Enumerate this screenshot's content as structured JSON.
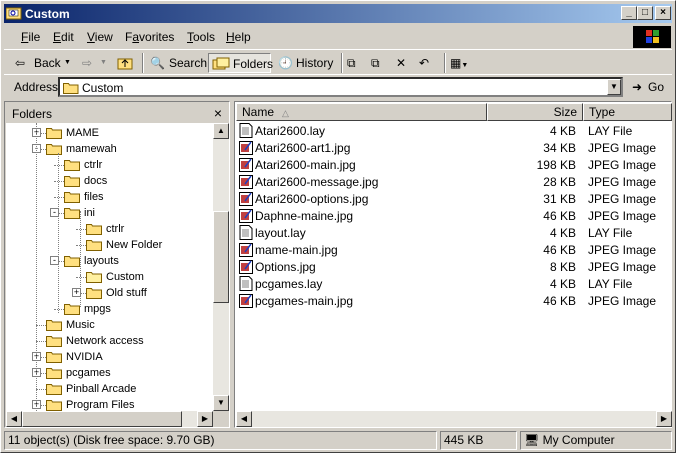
{
  "window": {
    "title": "Custom"
  },
  "menu": [
    "File",
    "Edit",
    "View",
    "Favorites",
    "Tools",
    "Help"
  ],
  "menu_underline": [
    "F",
    "E",
    "V",
    "a",
    "T",
    "H"
  ],
  "toolbar": {
    "back": "Back",
    "search": "Search",
    "folders": "Folders",
    "history": "History"
  },
  "address": {
    "label": "Address",
    "value": "Custom",
    "go": "Go"
  },
  "folders_pane": {
    "title": "Folders"
  },
  "tree": [
    {
      "label": "MAME",
      "indent": 0,
      "exp": "+"
    },
    {
      "label": "mamewah",
      "indent": 0,
      "exp": "-"
    },
    {
      "label": "ctrlr",
      "indent": 1,
      "exp": ""
    },
    {
      "label": "docs",
      "indent": 1,
      "exp": ""
    },
    {
      "label": "files",
      "indent": 1,
      "exp": ""
    },
    {
      "label": "ini",
      "indent": 1,
      "exp": "-"
    },
    {
      "label": "ctrlr",
      "indent": 2,
      "exp": ""
    },
    {
      "label": "New Folder",
      "indent": 2,
      "exp": ""
    },
    {
      "label": "layouts",
      "indent": 1,
      "exp": "-"
    },
    {
      "label": "Custom",
      "indent": 2,
      "exp": "",
      "open": true
    },
    {
      "label": "Old stuff",
      "indent": 2,
      "exp": "+"
    },
    {
      "label": "mpgs",
      "indent": 1,
      "exp": ""
    },
    {
      "label": "Music",
      "indent": 0,
      "exp": ""
    },
    {
      "label": "Network access",
      "indent": 0,
      "exp": ""
    },
    {
      "label": "NVIDIA",
      "indent": 0,
      "exp": "+"
    },
    {
      "label": "pcgames",
      "indent": 0,
      "exp": "+"
    },
    {
      "label": "Pinball Arcade",
      "indent": 0,
      "exp": ""
    },
    {
      "label": "Program Files",
      "indent": 0,
      "exp": "+"
    }
  ],
  "columns": {
    "name": "Name",
    "size": "Size",
    "type": "Type"
  },
  "files": [
    {
      "name": "Atari2600.lay",
      "size": "4 KB",
      "type": "LAY File",
      "kind": "lay"
    },
    {
      "name": "Atari2600-art1.jpg",
      "size": "34 KB",
      "type": "JPEG Image",
      "kind": "jpg"
    },
    {
      "name": "Atari2600-main.jpg",
      "size": "198 KB",
      "type": "JPEG Image",
      "kind": "jpg"
    },
    {
      "name": "Atari2600-message.jpg",
      "size": "28 KB",
      "type": "JPEG Image",
      "kind": "jpg"
    },
    {
      "name": "Atari2600-options.jpg",
      "size": "31 KB",
      "type": "JPEG Image",
      "kind": "jpg"
    },
    {
      "name": "Daphne-maine.jpg",
      "size": "46 KB",
      "type": "JPEG Image",
      "kind": "jpg"
    },
    {
      "name": "layout.lay",
      "size": "4 KB",
      "type": "LAY File",
      "kind": "lay"
    },
    {
      "name": "mame-main.jpg",
      "size": "46 KB",
      "type": "JPEG Image",
      "kind": "jpg"
    },
    {
      "name": "Options.jpg",
      "size": "8 KB",
      "type": "JPEG Image",
      "kind": "jpg"
    },
    {
      "name": "pcgames.lay",
      "size": "4 KB",
      "type": "LAY File",
      "kind": "lay"
    },
    {
      "name": "pcgames-main.jpg",
      "size": "46 KB",
      "type": "JPEG Image",
      "kind": "jpg"
    }
  ],
  "status": {
    "objects": "11 object(s) (Disk free space: 9.70 GB)",
    "size": "445 KB",
    "zone": "My Computer"
  }
}
